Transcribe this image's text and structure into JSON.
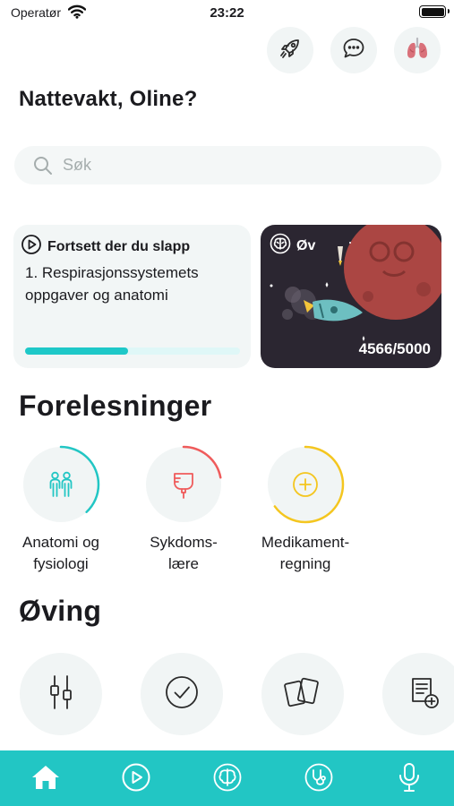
{
  "status_bar": {
    "carrier": "Operatør",
    "time": "23:22"
  },
  "top_actions": [
    {
      "name": "rocket-icon"
    },
    {
      "name": "chat-bubble-icon"
    },
    {
      "name": "lungs-icon"
    }
  ],
  "greeting": "Nattevakt, Oline?",
  "search": {
    "placeholder": "Søk",
    "value": ""
  },
  "continue_card": {
    "title": "Fortsett der du slapp",
    "lesson": "1. Respirasjonssystemets oppgaver og anatomi",
    "progress": 0.48
  },
  "game_card": {
    "label": "Øv",
    "score": "4566/5000",
    "score_value": 4566,
    "score_max": 5000
  },
  "lectures_section": {
    "title": "Forelesninger",
    "items": [
      {
        "line1": "Anatomi og",
        "line2": "fysiologi",
        "icon": "people-icon",
        "color": "#22c6c4",
        "progress": 0.38
      },
      {
        "line1": "Sykdoms-",
        "line2": "lære",
        "icon": "iv-bag-icon",
        "color": "#ef5b5b",
        "progress": 0.22
      },
      {
        "line1": "Medikament-",
        "line2": "regning",
        "icon": "plus-circle-icon",
        "color": "#f4c61f",
        "progress": 0.65
      }
    ]
  },
  "practice_section": {
    "title": "Øving",
    "items": [
      {
        "icon": "sliders-icon"
      },
      {
        "icon": "check-circle-icon"
      },
      {
        "icon": "flashcards-icon"
      },
      {
        "icon": "add-document-icon"
      }
    ]
  },
  "tab_bar": {
    "background": "#22c6c4",
    "tabs": [
      {
        "icon": "home-icon",
        "active": true
      },
      {
        "icon": "play-icon",
        "active": false
      },
      {
        "icon": "brain-icon",
        "active": false
      },
      {
        "icon": "stethoscope-icon",
        "active": false
      },
      {
        "icon": "microphone-icon",
        "active": false
      }
    ]
  }
}
